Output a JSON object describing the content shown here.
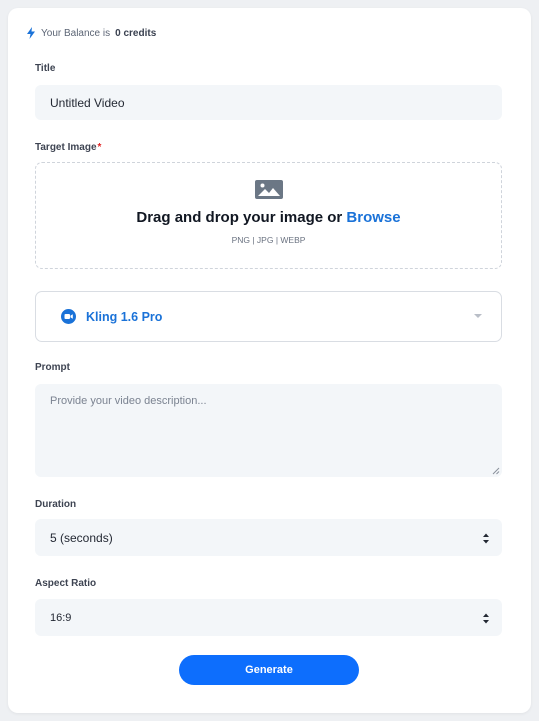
{
  "balance": {
    "prefix": "Your Balance is",
    "amount": "0 credits",
    "icon": "bolt-icon"
  },
  "title_field": {
    "label": "Title",
    "value": "Untitled Video"
  },
  "target_image": {
    "label": "Target Image",
    "required_mark": "*",
    "dropzone_text": "Drag and drop your image or",
    "browse_label": "Browse",
    "formats": "PNG | JPG | WEBP",
    "icon": "image-icon"
  },
  "model": {
    "selected": "Kling 1.6 Pro",
    "icon": "video-camera-icon"
  },
  "prompt": {
    "label": "Prompt",
    "placeholder": "Provide your video description..."
  },
  "duration": {
    "label": "Duration",
    "value": "5 (seconds)"
  },
  "aspect_ratio": {
    "label": "Aspect Ratio",
    "value": "16:9"
  },
  "generate_label": "Generate",
  "colors": {
    "accent": "#0d6efd",
    "link": "#1a72d8",
    "required": "#e02424",
    "field_bg": "#f3f6f9"
  }
}
